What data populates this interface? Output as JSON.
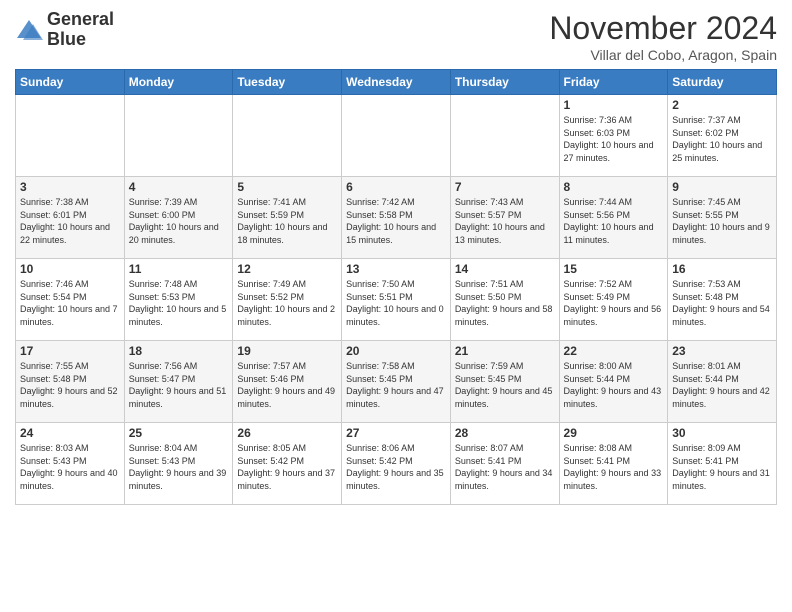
{
  "logo": {
    "line1": "General",
    "line2": "Blue"
  },
  "title": "November 2024",
  "subtitle": "Villar del Cobo, Aragon, Spain",
  "header": {
    "days": [
      "Sunday",
      "Monday",
      "Tuesday",
      "Wednesday",
      "Thursday",
      "Friday",
      "Saturday"
    ]
  },
  "weeks": [
    {
      "cells": [
        {
          "day": "",
          "info": ""
        },
        {
          "day": "",
          "info": ""
        },
        {
          "day": "",
          "info": ""
        },
        {
          "day": "",
          "info": ""
        },
        {
          "day": "",
          "info": ""
        },
        {
          "day": "1",
          "info": "Sunrise: 7:36 AM\nSunset: 6:03 PM\nDaylight: 10 hours\nand 27 minutes."
        },
        {
          "day": "2",
          "info": "Sunrise: 7:37 AM\nSunset: 6:02 PM\nDaylight: 10 hours\nand 25 minutes."
        }
      ]
    },
    {
      "cells": [
        {
          "day": "3",
          "info": "Sunrise: 7:38 AM\nSunset: 6:01 PM\nDaylight: 10 hours\nand 22 minutes."
        },
        {
          "day": "4",
          "info": "Sunrise: 7:39 AM\nSunset: 6:00 PM\nDaylight: 10 hours\nand 20 minutes."
        },
        {
          "day": "5",
          "info": "Sunrise: 7:41 AM\nSunset: 5:59 PM\nDaylight: 10 hours\nand 18 minutes."
        },
        {
          "day": "6",
          "info": "Sunrise: 7:42 AM\nSunset: 5:58 PM\nDaylight: 10 hours\nand 15 minutes."
        },
        {
          "day": "7",
          "info": "Sunrise: 7:43 AM\nSunset: 5:57 PM\nDaylight: 10 hours\nand 13 minutes."
        },
        {
          "day": "8",
          "info": "Sunrise: 7:44 AM\nSunset: 5:56 PM\nDaylight: 10 hours\nand 11 minutes."
        },
        {
          "day": "9",
          "info": "Sunrise: 7:45 AM\nSunset: 5:55 PM\nDaylight: 10 hours\nand 9 minutes."
        }
      ]
    },
    {
      "cells": [
        {
          "day": "10",
          "info": "Sunrise: 7:46 AM\nSunset: 5:54 PM\nDaylight: 10 hours\nand 7 minutes."
        },
        {
          "day": "11",
          "info": "Sunrise: 7:48 AM\nSunset: 5:53 PM\nDaylight: 10 hours\nand 5 minutes."
        },
        {
          "day": "12",
          "info": "Sunrise: 7:49 AM\nSunset: 5:52 PM\nDaylight: 10 hours\nand 2 minutes."
        },
        {
          "day": "13",
          "info": "Sunrise: 7:50 AM\nSunset: 5:51 PM\nDaylight: 10 hours\nand 0 minutes."
        },
        {
          "day": "14",
          "info": "Sunrise: 7:51 AM\nSunset: 5:50 PM\nDaylight: 9 hours\nand 58 minutes."
        },
        {
          "day": "15",
          "info": "Sunrise: 7:52 AM\nSunset: 5:49 PM\nDaylight: 9 hours\nand 56 minutes."
        },
        {
          "day": "16",
          "info": "Sunrise: 7:53 AM\nSunset: 5:48 PM\nDaylight: 9 hours\nand 54 minutes."
        }
      ]
    },
    {
      "cells": [
        {
          "day": "17",
          "info": "Sunrise: 7:55 AM\nSunset: 5:48 PM\nDaylight: 9 hours\nand 52 minutes."
        },
        {
          "day": "18",
          "info": "Sunrise: 7:56 AM\nSunset: 5:47 PM\nDaylight: 9 hours\nand 51 minutes."
        },
        {
          "day": "19",
          "info": "Sunrise: 7:57 AM\nSunset: 5:46 PM\nDaylight: 9 hours\nand 49 minutes."
        },
        {
          "day": "20",
          "info": "Sunrise: 7:58 AM\nSunset: 5:45 PM\nDaylight: 9 hours\nand 47 minutes."
        },
        {
          "day": "21",
          "info": "Sunrise: 7:59 AM\nSunset: 5:45 PM\nDaylight: 9 hours\nand 45 minutes."
        },
        {
          "day": "22",
          "info": "Sunrise: 8:00 AM\nSunset: 5:44 PM\nDaylight: 9 hours\nand 43 minutes."
        },
        {
          "day": "23",
          "info": "Sunrise: 8:01 AM\nSunset: 5:44 PM\nDaylight: 9 hours\nand 42 minutes."
        }
      ]
    },
    {
      "cells": [
        {
          "day": "24",
          "info": "Sunrise: 8:03 AM\nSunset: 5:43 PM\nDaylight: 9 hours\nand 40 minutes."
        },
        {
          "day": "25",
          "info": "Sunrise: 8:04 AM\nSunset: 5:43 PM\nDaylight: 9 hours\nand 39 minutes."
        },
        {
          "day": "26",
          "info": "Sunrise: 8:05 AM\nSunset: 5:42 PM\nDaylight: 9 hours\nand 37 minutes."
        },
        {
          "day": "27",
          "info": "Sunrise: 8:06 AM\nSunset: 5:42 PM\nDaylight: 9 hours\nand 35 minutes."
        },
        {
          "day": "28",
          "info": "Sunrise: 8:07 AM\nSunset: 5:41 PM\nDaylight: 9 hours\nand 34 minutes."
        },
        {
          "day": "29",
          "info": "Sunrise: 8:08 AM\nSunset: 5:41 PM\nDaylight: 9 hours\nand 33 minutes."
        },
        {
          "day": "30",
          "info": "Sunrise: 8:09 AM\nSunset: 5:41 PM\nDaylight: 9 hours\nand 31 minutes."
        }
      ]
    }
  ]
}
